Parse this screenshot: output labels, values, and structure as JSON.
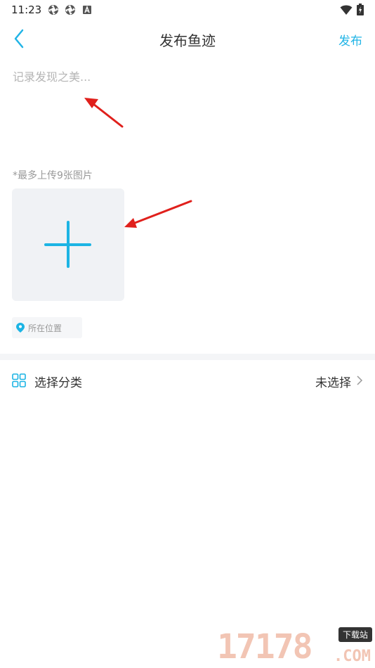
{
  "status_bar": {
    "time": "11:23"
  },
  "nav": {
    "title": "发布鱼迹",
    "publish_label": "发布"
  },
  "post": {
    "placeholder": "记录发现之美..."
  },
  "upload": {
    "hint": "*最多上传9张图片"
  },
  "location": {
    "label": "所在位置"
  },
  "category": {
    "label": "选择分类",
    "value": "未选择"
  },
  "watermark": {
    "digits": "17178",
    "badge": "下载站",
    "suffix": ".COM"
  },
  "colors": {
    "accent": "#21b4e6",
    "arrow": "#e0201c"
  },
  "icons": {
    "back": "chevron-left-icon",
    "location": "map-pin-icon",
    "category": "grid-icon",
    "chevron": "chevron-right-icon"
  }
}
